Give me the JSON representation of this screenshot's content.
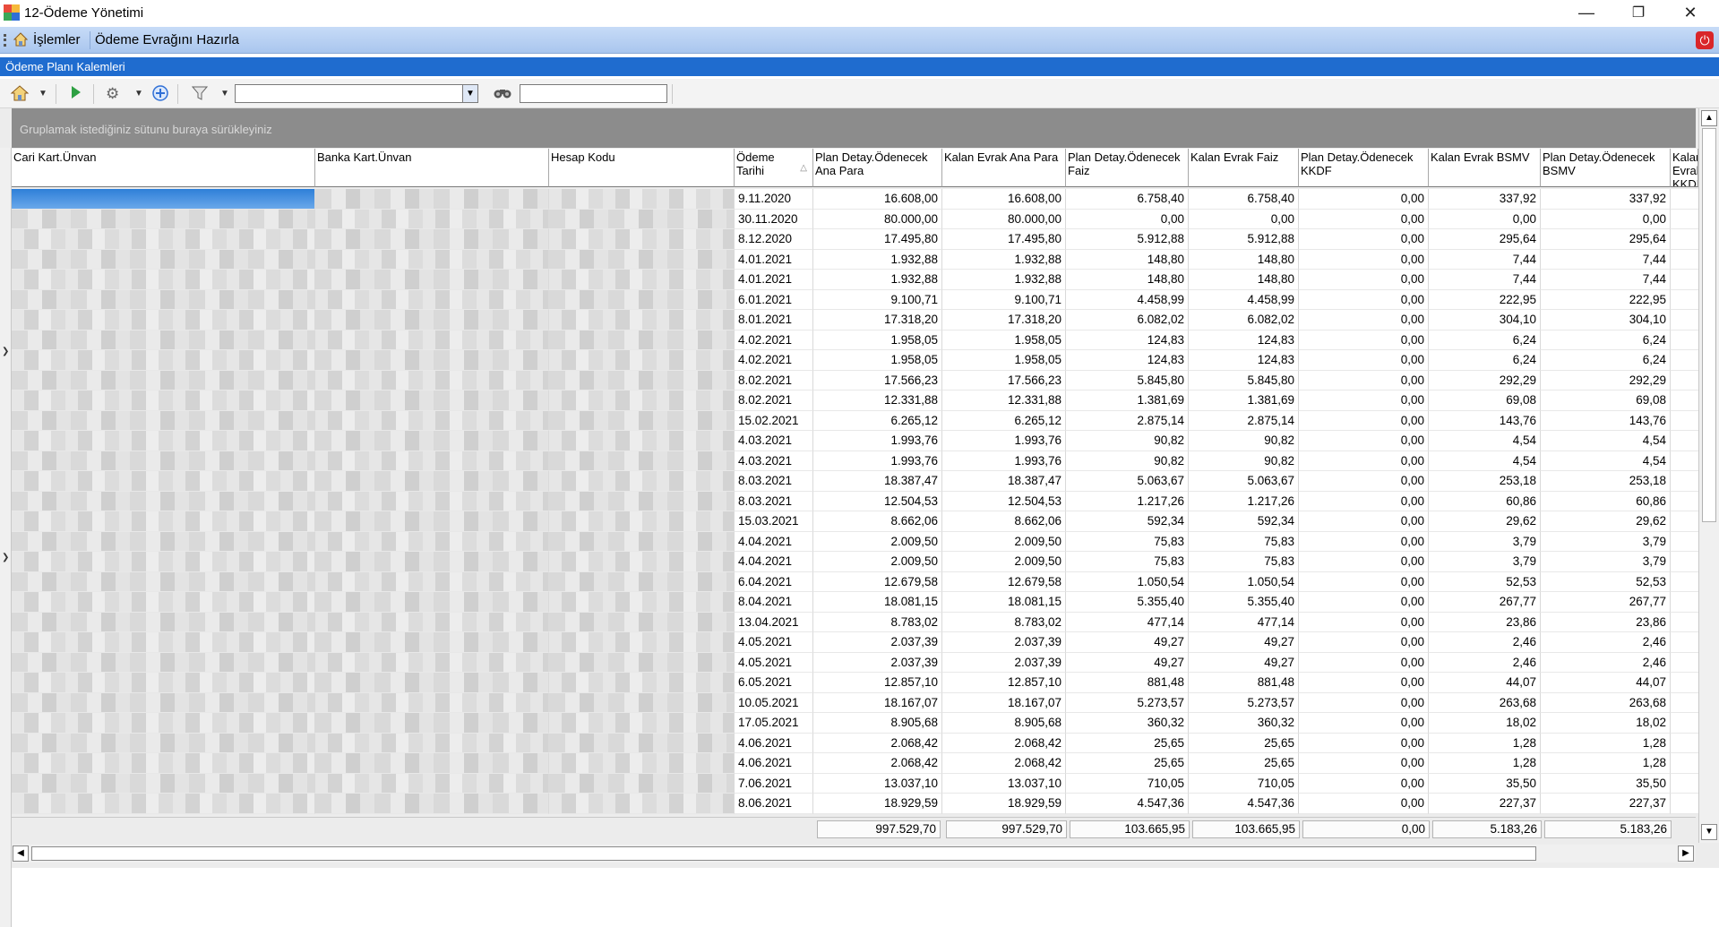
{
  "window": {
    "title": "12-Ödeme Yönetimi",
    "min": "—",
    "max": "❐",
    "close": "✕"
  },
  "menu": {
    "islemler": "İşlemler",
    "odeme_evragi": "Ödeme Evrağını Hazırla"
  },
  "section_title": "Ödeme Planı Kalemleri",
  "group_panel_text": "Gruplamak istediğiniz sütunu buraya sürükleyiniz",
  "columns": {
    "cari": "Cari Kart.Ünvan",
    "banka": "Banka Kart.Ünvan",
    "hesap": "Hesap Kodu",
    "tarih": "Ödeme Tarihi",
    "plan_anapara": "Plan Detay.Ödenecek Ana Para",
    "kalan_anapara": "Kalan Evrak Ana Para",
    "plan_faiz": "Plan Detay.Ödenecek Faiz",
    "kalan_faiz": "Kalan Evrak Faiz",
    "plan_kkdf": "Plan Detay.Ödenecek KKDF",
    "kalan_bsmv": "Kalan Evrak BSMV",
    "plan_bsmv": "Plan Detay.Ödenecek BSMV",
    "kalan_kkdf": "Kalan Evrak KKDF"
  },
  "rows": [
    [
      "9.11.2020",
      "16.608,00",
      "16.608,00",
      "6.758,40",
      "6.758,40",
      "0,00",
      "337,92",
      "337,92"
    ],
    [
      "30.11.2020",
      "80.000,00",
      "80.000,00",
      "0,00",
      "0,00",
      "0,00",
      "0,00",
      "0,00"
    ],
    [
      "8.12.2020",
      "17.495,80",
      "17.495,80",
      "5.912,88",
      "5.912,88",
      "0,00",
      "295,64",
      "295,64"
    ],
    [
      "4.01.2021",
      "1.932,88",
      "1.932,88",
      "148,80",
      "148,80",
      "0,00",
      "7,44",
      "7,44"
    ],
    [
      "4.01.2021",
      "1.932,88",
      "1.932,88",
      "148,80",
      "148,80",
      "0,00",
      "7,44",
      "7,44"
    ],
    [
      "6.01.2021",
      "9.100,71",
      "9.100,71",
      "4.458,99",
      "4.458,99",
      "0,00",
      "222,95",
      "222,95"
    ],
    [
      "8.01.2021",
      "17.318,20",
      "17.318,20",
      "6.082,02",
      "6.082,02",
      "0,00",
      "304,10",
      "304,10"
    ],
    [
      "4.02.2021",
      "1.958,05",
      "1.958,05",
      "124,83",
      "124,83",
      "0,00",
      "6,24",
      "6,24"
    ],
    [
      "4.02.2021",
      "1.958,05",
      "1.958,05",
      "124,83",
      "124,83",
      "0,00",
      "6,24",
      "6,24"
    ],
    [
      "8.02.2021",
      "17.566,23",
      "17.566,23",
      "5.845,80",
      "5.845,80",
      "0,00",
      "292,29",
      "292,29"
    ],
    [
      "8.02.2021",
      "12.331,88",
      "12.331,88",
      "1.381,69",
      "1.381,69",
      "0,00",
      "69,08",
      "69,08"
    ],
    [
      "15.02.2021",
      "6.265,12",
      "6.265,12",
      "2.875,14",
      "2.875,14",
      "0,00",
      "143,76",
      "143,76"
    ],
    [
      "4.03.2021",
      "1.993,76",
      "1.993,76",
      "90,82",
      "90,82",
      "0,00",
      "4,54",
      "4,54"
    ],
    [
      "4.03.2021",
      "1.993,76",
      "1.993,76",
      "90,82",
      "90,82",
      "0,00",
      "4,54",
      "4,54"
    ],
    [
      "8.03.2021",
      "18.387,47",
      "18.387,47",
      "5.063,67",
      "5.063,67",
      "0,00",
      "253,18",
      "253,18"
    ],
    [
      "8.03.2021",
      "12.504,53",
      "12.504,53",
      "1.217,26",
      "1.217,26",
      "0,00",
      "60,86",
      "60,86"
    ],
    [
      "15.03.2021",
      "8.662,06",
      "8.662,06",
      "592,34",
      "592,34",
      "0,00",
      "29,62",
      "29,62"
    ],
    [
      "4.04.2021",
      "2.009,50",
      "2.009,50",
      "75,83",
      "75,83",
      "0,00",
      "3,79",
      "3,79"
    ],
    [
      "4.04.2021",
      "2.009,50",
      "2.009,50",
      "75,83",
      "75,83",
      "0,00",
      "3,79",
      "3,79"
    ],
    [
      "6.04.2021",
      "12.679,58",
      "12.679,58",
      "1.050,54",
      "1.050,54",
      "0,00",
      "52,53",
      "52,53"
    ],
    [
      "8.04.2021",
      "18.081,15",
      "18.081,15",
      "5.355,40",
      "5.355,40",
      "0,00",
      "267,77",
      "267,77"
    ],
    [
      "13.04.2021",
      "8.783,02",
      "8.783,02",
      "477,14",
      "477,14",
      "0,00",
      "23,86",
      "23,86"
    ],
    [
      "4.05.2021",
      "2.037,39",
      "2.037,39",
      "49,27",
      "49,27",
      "0,00",
      "2,46",
      "2,46"
    ],
    [
      "4.05.2021",
      "2.037,39",
      "2.037,39",
      "49,27",
      "49,27",
      "0,00",
      "2,46",
      "2,46"
    ],
    [
      "6.05.2021",
      "12.857,10",
      "12.857,10",
      "881,48",
      "881,48",
      "0,00",
      "44,07",
      "44,07"
    ],
    [
      "10.05.2021",
      "18.167,07",
      "18.167,07",
      "5.273,57",
      "5.273,57",
      "0,00",
      "263,68",
      "263,68"
    ],
    [
      "17.05.2021",
      "8.905,68",
      "8.905,68",
      "360,32",
      "360,32",
      "0,00",
      "18,02",
      "18,02"
    ],
    [
      "4.06.2021",
      "2.068,42",
      "2.068,42",
      "25,65",
      "25,65",
      "0,00",
      "1,28",
      "1,28"
    ],
    [
      "4.06.2021",
      "2.068,42",
      "2.068,42",
      "25,65",
      "25,65",
      "0,00",
      "1,28",
      "1,28"
    ],
    [
      "7.06.2021",
      "13.037,10",
      "13.037,10",
      "710,05",
      "710,05",
      "0,00",
      "35,50",
      "35,50"
    ],
    [
      "8.06.2021",
      "18.929,59",
      "18.929,59",
      "4.547,36",
      "4.547,36",
      "0,00",
      "227,37",
      "227,37"
    ]
  ],
  "totals": [
    "997.529,70",
    "997.529,70",
    "103.665,95",
    "103.665,95",
    "0,00",
    "5.183,26",
    "5.183,26"
  ],
  "colors": {
    "section": "#1f6ccf",
    "menubar": "#b8d1f3",
    "selected_row": "#2e7fd8"
  }
}
